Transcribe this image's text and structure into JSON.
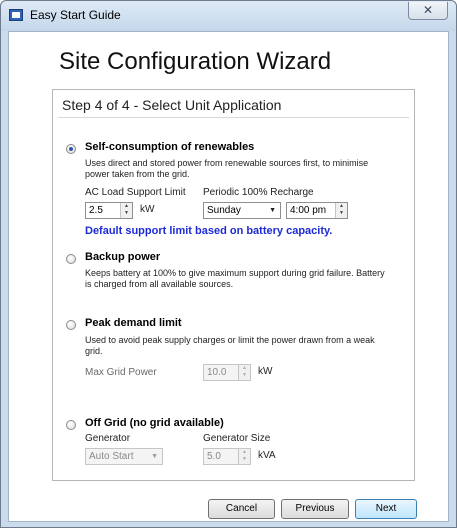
{
  "window": {
    "title": "Easy Start Guide",
    "close_glyph": "✕"
  },
  "heading": "Site Configuration Wizard",
  "step": "Step 4 of 4 - Select Unit Application",
  "options": {
    "self_consumption": {
      "label": "Self-consumption of renewables",
      "selected": true,
      "description": "Uses direct and stored power from renewable sources first, to minimise power taken from the grid.",
      "load_limit_label": "AC Load Support Limit",
      "load_limit_value": "2.5",
      "load_limit_unit": "kW",
      "recharge_label": "Periodic 100% Recharge",
      "recharge_day": "Sunday",
      "recharge_time": "4:00 pm",
      "note": "Default support limit based on battery capacity."
    },
    "backup": {
      "label": "Backup power",
      "selected": false,
      "description": "Keeps battery at 100% to give maximum support during grid failure. Battery is charged from all available sources."
    },
    "peak_demand": {
      "label": "Peak demand limit",
      "selected": false,
      "description": "Used to avoid peak supply charges or limit the power drawn from a weak grid.",
      "max_grid_label": "Max Grid Power",
      "max_grid_value": "10.0",
      "max_grid_unit": "kW"
    },
    "off_grid": {
      "label": "Off Grid (no grid available)",
      "selected": false,
      "generator_label": "Generator",
      "generator_value": "Auto Start",
      "generator_size_label": "Generator Size",
      "generator_size_value": "5.0",
      "generator_size_unit": "kVA"
    }
  },
  "buttons": {
    "cancel": "Cancel",
    "previous": "Previous",
    "next": "Next"
  },
  "icons": {
    "spin_up": "▲",
    "spin_down": "▼",
    "dropdown": "▼"
  },
  "colors": {
    "note": "#1d2bd6",
    "radio_selected": "#2b59b2"
  }
}
